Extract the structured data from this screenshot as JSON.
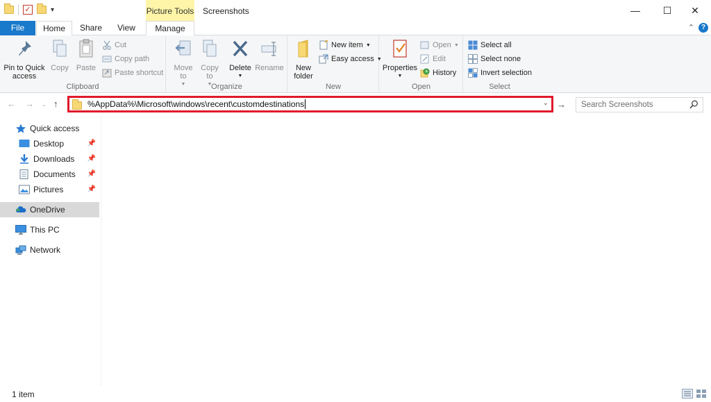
{
  "window": {
    "title": "Screenshots",
    "context_tab_group": "Picture Tools",
    "controls": {
      "minimize": "—",
      "maximize": "☐",
      "close": "✕"
    }
  },
  "ribbon_tabs": [
    "File",
    "Home",
    "Share",
    "View",
    "Manage"
  ],
  "ribbon": {
    "collapse": "⌃",
    "help": "?",
    "groups": {
      "clipboard": {
        "label": "Clipboard",
        "pin": "Pin to Quick access",
        "copy": "Copy",
        "paste": "Paste",
        "cut": "Cut",
        "copy_path": "Copy path",
        "paste_shortcut": "Paste shortcut"
      },
      "organize": {
        "label": "Organize",
        "move_to": "Move to",
        "copy_to": "Copy to",
        "delete": "Delete",
        "rename": "Rename"
      },
      "new": {
        "label": "New",
        "new_folder": "New folder",
        "new_item": "New item",
        "easy_access": "Easy access"
      },
      "open": {
        "label": "Open",
        "properties": "Properties",
        "open": "Open",
        "edit": "Edit",
        "history": "History"
      },
      "select": {
        "label": "Select",
        "select_all": "Select all",
        "select_none": "Select none",
        "invert_selection": "Invert selection"
      }
    }
  },
  "address_bar": {
    "value": "%AppData%\\Microsoft\\windows\\recent\\customdestinations",
    "highlight_color": "#e0192b"
  },
  "search": {
    "placeholder": "Search Screenshots"
  },
  "nav_pane": {
    "quick_access": "Quick access",
    "pinned": [
      "Desktop",
      "Downloads",
      "Documents",
      "Pictures"
    ],
    "onedrive": "OneDrive",
    "this_pc": "This PC",
    "network": "Network"
  },
  "status": {
    "item_count": "1 item"
  },
  "colors": {
    "accent": "#1979ca",
    "context_tab": "#fff5a8"
  }
}
